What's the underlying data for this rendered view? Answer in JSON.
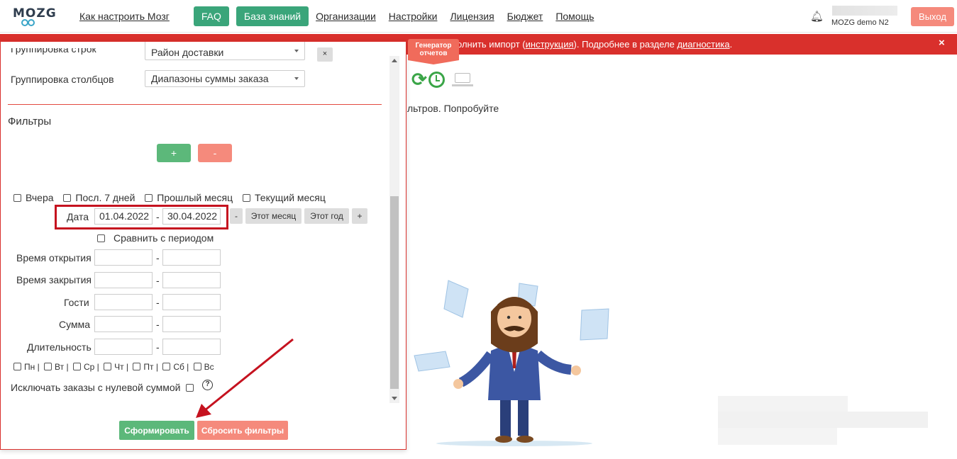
{
  "nav": {
    "logo": "MOZG",
    "links": [
      "Как настроить Мозг",
      "FAQ",
      "База знаний",
      "Организации",
      "Настройки",
      "Лицензия",
      "Бюджет",
      "Помощь"
    ],
    "user_name": "MOZG demo N2",
    "logout": "Выход"
  },
  "alert": {
    "prefix": "олнить импорт (",
    "link1": "инструкция",
    "middle": "). Подробнее в разделе ",
    "link2": "диагностика",
    "suffix": ".",
    "close": "×"
  },
  "generator_tag": "Генератор отчетов",
  "hint_text": "льтров. Попробуйте",
  "panel": {
    "row_grouping_label": "Группировка строк",
    "row_grouping_value": "Район доставки",
    "col_grouping_label": "Группировка столбцов",
    "col_grouping_value": "Диапазоны суммы заказа",
    "remove": "×",
    "filters_title": "Фильтры",
    "add": "+",
    "remove_filter": "-",
    "quick": [
      "Вчера",
      "Посл. 7 дней",
      "Прошлый месяц",
      "Текущий месяц"
    ],
    "date_label": "Дата",
    "date_from": "01.04.2022",
    "date_to": "30.04.2022",
    "dash": "-",
    "btn_minus": "-",
    "btn_this_month": "Этот месяц",
    "btn_this_year": "Этот год",
    "btn_plus": "+",
    "compare": "Сравнить с периодом",
    "open_time": "Время открытия",
    "close_time": "Время закрытия",
    "guests": "Гости",
    "sum": "Сумма",
    "duration": "Длительность",
    "days": [
      "Пн |",
      "Вт |",
      "Ср |",
      "Чт |",
      "Пт |",
      "Сб |",
      "Вс"
    ],
    "exclude_zero": "Исключать заказы с нулевой суммой",
    "help": "?",
    "generate": "Сформировать",
    "reset": "Сбросить фильтры"
  },
  "colors": {
    "accent_green": "#3aa57a",
    "alert_red": "#d9302c",
    "soft_red": "#f58a7c"
  }
}
